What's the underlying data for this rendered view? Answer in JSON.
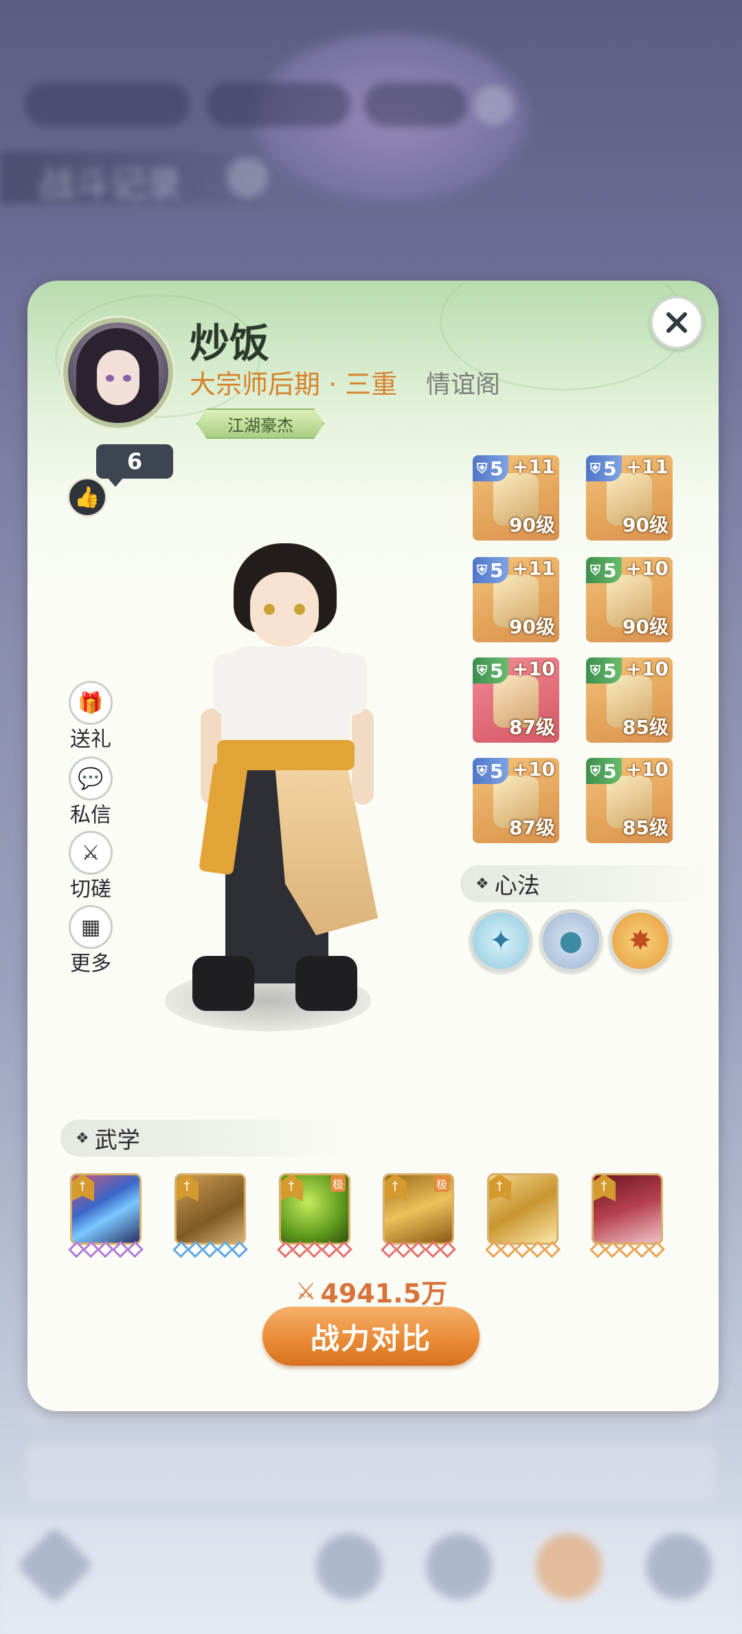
{
  "background": {
    "title": "战斗记录"
  },
  "profile": {
    "name": "炒饭",
    "rank": "大宗师后期 · 三重",
    "guild": "情谊阁",
    "title_badge": "江湖豪杰",
    "likes": "6"
  },
  "side_actions": [
    {
      "label": "送礼",
      "icon": "gift-icon"
    },
    {
      "label": "私信",
      "icon": "message-icon"
    },
    {
      "label": "切磋",
      "icon": "crossed-swords-icon"
    },
    {
      "label": "更多",
      "icon": "more-grid-icon"
    }
  ],
  "equipment": [
    {
      "tier": "5",
      "tier_color": "blue",
      "plus": "+11",
      "level": "90级",
      "bg": "gold",
      "icon": "sword-icon"
    },
    {
      "tier": "5",
      "tier_color": "blue",
      "plus": "+11",
      "level": "90级",
      "bg": "gold",
      "icon": "helmet-icon"
    },
    {
      "tier": "5",
      "tier_color": "blue",
      "plus": "+11",
      "level": "90级",
      "bg": "gold",
      "icon": "armor-icon"
    },
    {
      "tier": "5",
      "tier_color": "green",
      "plus": "+10",
      "level": "90级",
      "bg": "gold",
      "icon": "pants-icon"
    },
    {
      "tier": "5",
      "tier_color": "green",
      "plus": "+10",
      "level": "87级",
      "bg": "pink",
      "icon": "boots-icon"
    },
    {
      "tier": "5",
      "tier_color": "green",
      "plus": "+10",
      "level": "85级",
      "bg": "gold",
      "icon": "greaves-icon"
    },
    {
      "tier": "5",
      "tier_color": "blue",
      "plus": "+10",
      "level": "87级",
      "bg": "gold",
      "icon": "ring-icon"
    },
    {
      "tier": "5",
      "tier_color": "green",
      "plus": "+10",
      "level": "85级",
      "bg": "gold",
      "icon": "amulet-icon"
    }
  ],
  "xinfa": {
    "label": "心法",
    "items": [
      "kick-pose-icon",
      "meditation-icon",
      "flame-figure-icon"
    ]
  },
  "wuxue": {
    "label": "武学",
    "skills": [
      {
        "icon": "comet-strike-icon",
        "stars": "purple",
        "limit": ""
      },
      {
        "icon": "dancing-figures-icon",
        "stars": "blue",
        "limit": ""
      },
      {
        "icon": "green-slash-icon",
        "stars": "red",
        "limit": "极"
      },
      {
        "icon": "golden-swords-icon",
        "stars": "red",
        "limit": "极"
      },
      {
        "icon": "golden-blade-icon",
        "stars": "orange",
        "limit": ""
      },
      {
        "icon": "crimson-swords-icon",
        "stars": "orange",
        "limit": ""
      }
    ]
  },
  "power": {
    "value": "4941.5万",
    "compare_label": "战力对比"
  },
  "colors": {
    "accent_orange": "#e88934",
    "rank_text": "#d5822a",
    "card_top": "#b8dcae",
    "card_body": "#fbfcf6"
  }
}
